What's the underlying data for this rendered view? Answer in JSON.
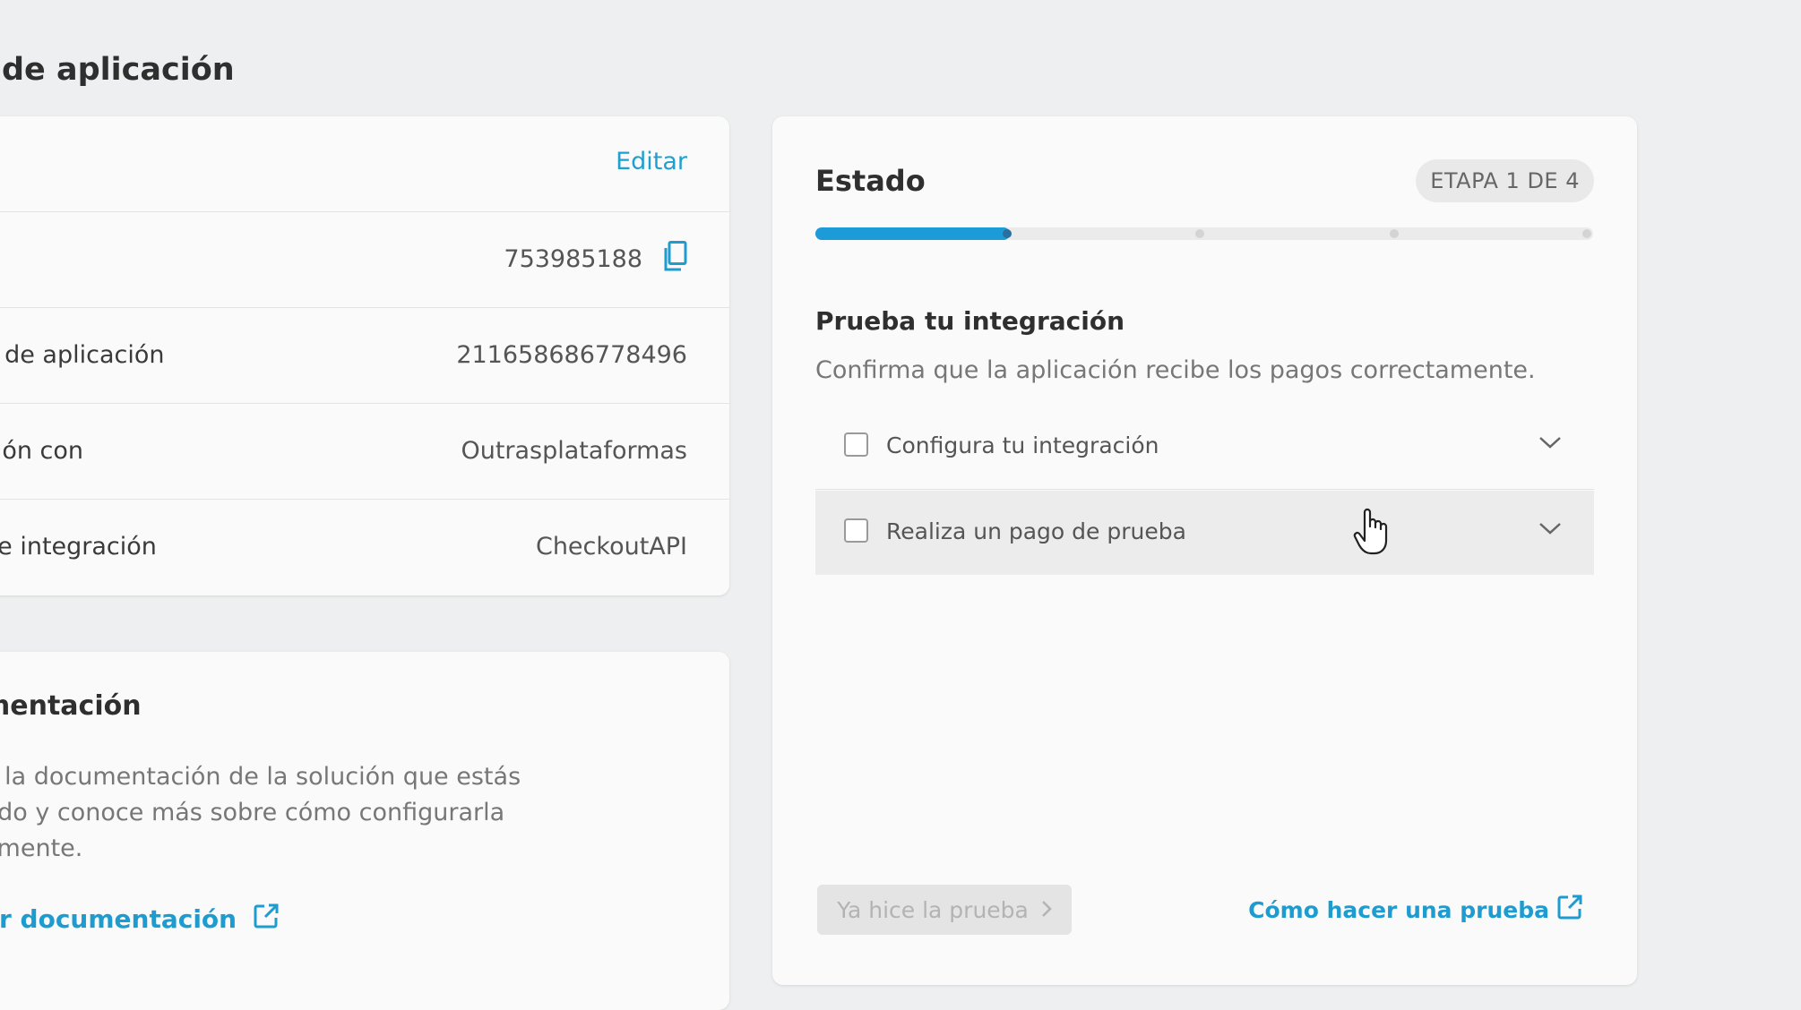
{
  "page": {
    "title": "de aplicación"
  },
  "details": {
    "edit_label": "Editar",
    "rows": [
      {
        "label": ":",
        "value": "753985188"
      },
      {
        "label": "o de aplicación",
        "value": "211658686778496"
      },
      {
        "label": "ción con",
        "value": "Outrasplataformas"
      },
      {
        "label": "de integración",
        "value": "CheckoutAPI"
      }
    ]
  },
  "docs": {
    "title": "mentación",
    "body_lines": [
      "a la documentación de la solución que estás",
      "ndo y conoce más sobre cómo configurarla",
      "amente."
    ],
    "link_label": "er documentación"
  },
  "status": {
    "title": "Estado",
    "stage_badge": "ETAPA 1 DE 4",
    "progress_fraction": 0.25,
    "accent_color": "#1c9bd8",
    "section_title": "Prueba tu integración",
    "section_subtitle": "Confirma que la aplicación recibe los pagos correctamente.",
    "steps": [
      {
        "label": "Configura tu integración",
        "checked": false
      },
      {
        "label": "Realiza un pago de prueba",
        "checked": false
      }
    ],
    "done_button_label": "Ya hice la prueba",
    "how_link_label": "Cómo hacer una prueba"
  },
  "icons": {
    "copy": "copy-icon",
    "external": "external-link-icon",
    "chevron": "chevron-down-icon",
    "arrow": "chevron-right-icon",
    "cursor": "hand-cursor-icon"
  }
}
